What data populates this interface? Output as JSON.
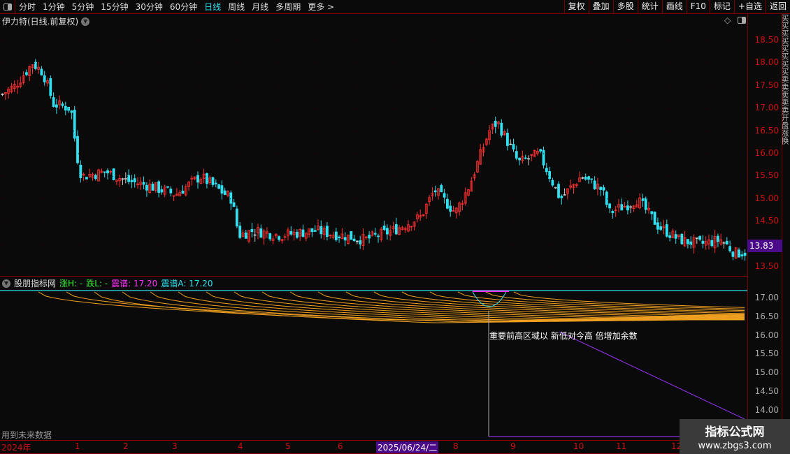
{
  "toolbar": {
    "periods": [
      "分时",
      "1分钟",
      "5分钟",
      "15分钟",
      "30分钟",
      "60分钟",
      "日线",
      "周线",
      "月线",
      "多周期",
      "更多 >"
    ],
    "active_period": "日线",
    "right_buttons": [
      "复权",
      "叠加",
      "多股",
      "统计",
      "画线",
      "F10",
      "标记",
      "+自选",
      "返回"
    ]
  },
  "stock": {
    "title": "伊力特(日线.前复权)"
  },
  "main_axis": [
    "18.50",
    "18.00",
    "17.50",
    "17.00",
    "16.50",
    "16.00",
    "15.50",
    "15.00",
    "14.50",
    "13.50"
  ],
  "last_price": "13.83",
  "indicator": {
    "name": "股朋指标网",
    "zhang": "涨H: -",
    "die": "跌L: -",
    "zhenpu": "震谱: 17.20",
    "zhenpuA": "震谱A: 17.20",
    "annotation": "重要前高区域以 新低对今高 倍增加余数",
    "axis": [
      "17.00",
      "16.50",
      "16.00",
      "15.50",
      "15.00",
      "14.50",
      "14.00"
    ],
    "future_note": "用到未来数据"
  },
  "xaxis": {
    "labels": [
      "2024年",
      "1",
      "2",
      "3",
      "4",
      "5",
      "6",
      "8",
      "9",
      "10",
      "11",
      "12"
    ],
    "selected_date": "2025/06/24/二"
  },
  "watermark": {
    "line1": "指标公式网",
    "line2": "www.zbgs3.com"
  },
  "colors": {
    "up": "#ff3030",
    "down": "#30e0f0",
    "flat": "#cccccc",
    "axis": "#d01010",
    "fan": "#f0a020",
    "cyan": "#30e0f0",
    "purple": "#8a30e0"
  },
  "chart_data": {
    "type": "candlestick",
    "ylim": [
      13.35,
      18.85
    ],
    "approx_close_path": [
      [
        0,
        17.3
      ],
      [
        20,
        17.5
      ],
      [
        45,
        18.0
      ],
      [
        60,
        17.8
      ],
      [
        75,
        17.1
      ],
      [
        100,
        17.0
      ],
      [
        108,
        16.0
      ],
      [
        115,
        15.5
      ],
      [
        150,
        15.6
      ],
      [
        180,
        15.4
      ],
      [
        210,
        15.3
      ],
      [
        250,
        15.1
      ],
      [
        285,
        15.5
      ],
      [
        330,
        15.0
      ],
      [
        340,
        14.2
      ],
      [
        360,
        14.3
      ],
      [
        400,
        14.2
      ],
      [
        450,
        14.3
      ],
      [
        520,
        14.1
      ],
      [
        560,
        14.3
      ],
      [
        600,
        14.6
      ],
      [
        620,
        15.2
      ],
      [
        650,
        14.7
      ],
      [
        670,
        15.3
      ],
      [
        698,
        16.5
      ],
      [
        710,
        16.7
      ],
      [
        740,
        15.8
      ],
      [
        770,
        16.0
      ],
      [
        800,
        15.0
      ],
      [
        830,
        15.5
      ],
      [
        860,
        15.2
      ],
      [
        870,
        14.7
      ],
      [
        900,
        14.9
      ],
      [
        910,
        15.0
      ],
      [
        940,
        14.4
      ],
      [
        970,
        14.1
      ],
      [
        1000,
        14.0
      ],
      [
        1030,
        14.1
      ],
      [
        1050,
        13.8
      ],
      [
        1068,
        13.83
      ]
    ]
  }
}
